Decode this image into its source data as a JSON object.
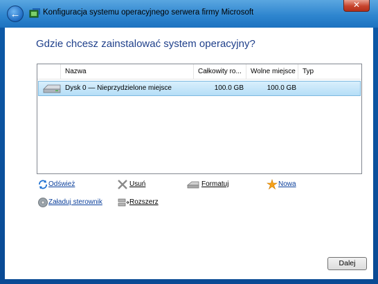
{
  "window": {
    "title": "Konfiguracja systemu operacyjnego serwera firmy Microsoft",
    "close_label": "✕"
  },
  "page": {
    "heading": "Gdzie chcesz zainstalować system operacyjny?"
  },
  "table": {
    "columns": [
      "Nazwa",
      "Całkowity ro...",
      "Wolne miejsce",
      "Typ"
    ],
    "rows": [
      {
        "name": "Dysk 0 — Nieprzydzielone miejsce",
        "total": "100.0 GB",
        "free": "100.0 GB",
        "type": "",
        "selected": true,
        "icon": "disk-icon"
      }
    ]
  },
  "actions": {
    "refresh": "Odśwież",
    "delete": "Usuń",
    "format": "Formatuj",
    "new": "Nowa",
    "load_driver": "Załaduj sterownik",
    "extend": "Rozszerz"
  },
  "footer": {
    "next_label": "Dalej"
  },
  "colors": {
    "titlebar": "#2f86cf",
    "heading": "#1e3f8a",
    "link": "#0b3f9b",
    "selection": "#cbe8f6",
    "close": "#c7442d"
  }
}
